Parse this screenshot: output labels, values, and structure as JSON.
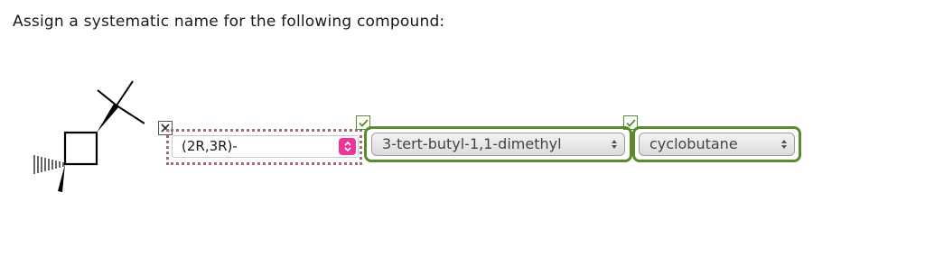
{
  "question": {
    "text": "Assign a systematic name for the following compound:"
  },
  "answer": {
    "stereo_prefix": {
      "value": "(2R,3R)-",
      "status": "incorrect"
    },
    "substituents": {
      "value": "3-tert-butyl-1,1-dimethyl",
      "status": "correct"
    },
    "parent": {
      "value": "cyclobutane",
      "status": "correct"
    }
  },
  "colors": {
    "correct": "#5a8a2a",
    "incorrect": "#a46a7e",
    "accent": "#e8379a"
  },
  "icons": {
    "incorrect_mark": "x-mark-icon",
    "correct_mark": "check-mark-icon",
    "select_arrow": "chevron-updown-icon",
    "select_updown": "updown-arrows-icon"
  }
}
